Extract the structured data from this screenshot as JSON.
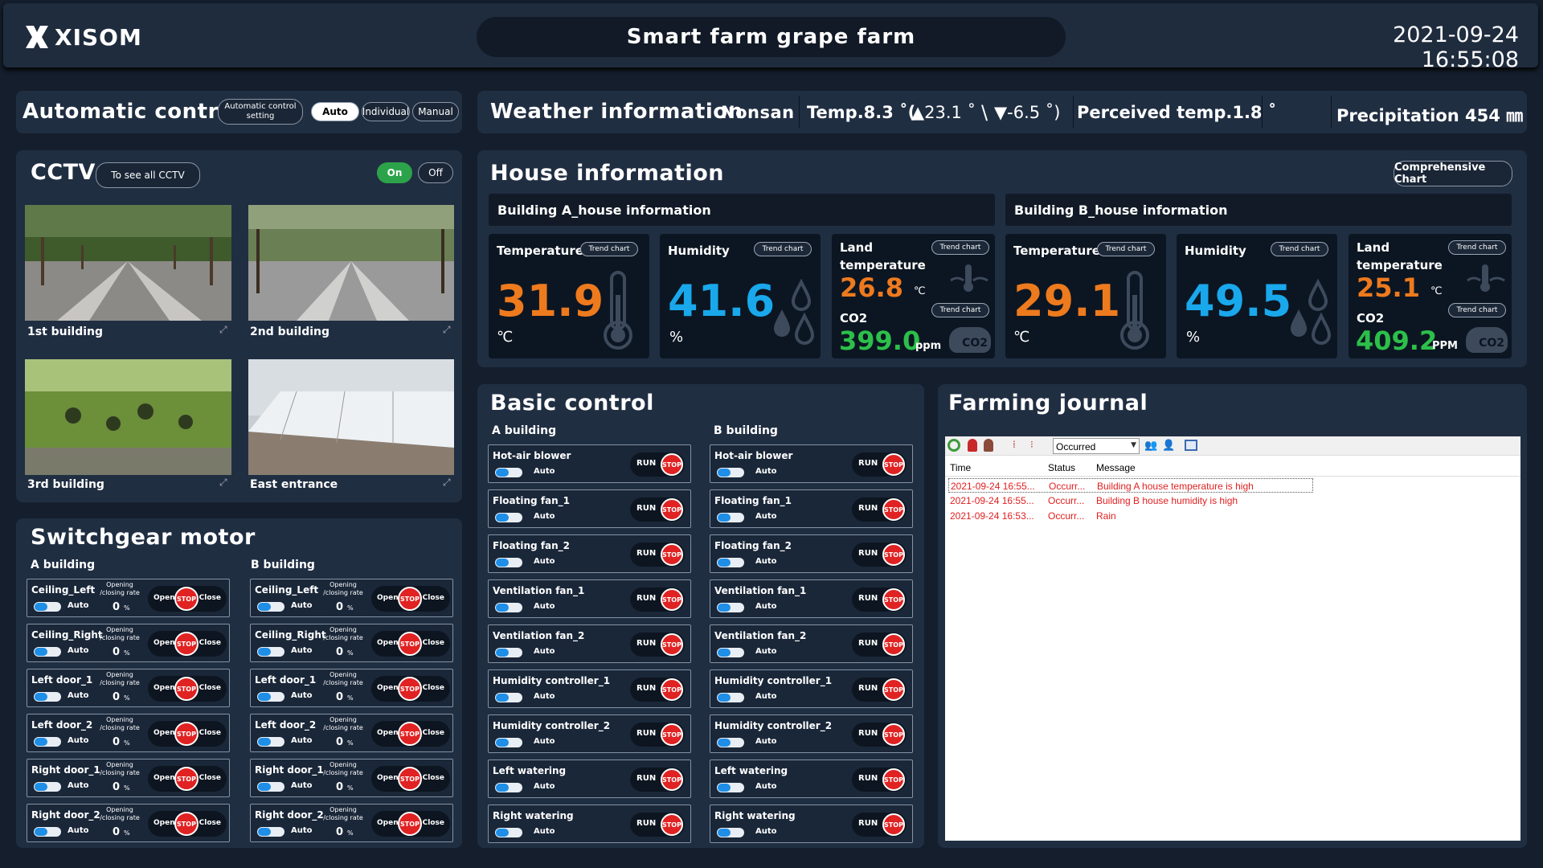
{
  "header": {
    "logo": "XISOM",
    "title": "Smart farm grape farm",
    "datetime": "2021-09-24 16:55:08"
  },
  "auto_control": {
    "title": "Automatic control",
    "setting_line1": "Automatic control",
    "setting_line2": "setting",
    "modes": [
      "Auto",
      "Individual",
      "Manual"
    ],
    "active_mode": "Auto"
  },
  "weather": {
    "title": "Weather information",
    "location": "Nonsan",
    "temp": "Temp.8.3 ˚(",
    "high": "▲23.1 ˚",
    "sep": "\\",
    "low": "▼-6.5 ˚)",
    "perceived": "Perceived temp.1.8 ˚",
    "precip": "Precipitation 454 ㎜"
  },
  "cctv": {
    "title": "CCTV",
    "see_all": "To see all CCTV",
    "on": "On",
    "off": "Off",
    "cams": [
      "1st building",
      "2nd building",
      "3rd building",
      "East entrance"
    ]
  },
  "house": {
    "title": "House information",
    "chart_button": "Comprehensive Chart",
    "a_title": "Building A_house information",
    "b_title": "Building B_house information",
    "trend": "Trend chart",
    "labels": {
      "temperature": "Temperature",
      "humidity": "Humidity",
      "land1": "Land",
      "land2": "temperature",
      "co2": "CO2"
    },
    "units": {
      "celsius": "℃",
      "percent": "%",
      "ppm": "ppm",
      "ppm_b": "PPM",
      "co2_icon": "CO2"
    },
    "a": {
      "temp": "31.9",
      "hum": "41.6",
      "land": "26.8",
      "co2": "399.0"
    },
    "b": {
      "temp": "29.1",
      "hum": "49.5",
      "land": "25.1",
      "co2": "409.2"
    }
  },
  "switchgear": {
    "title": "Switchgear motor",
    "a": "A building",
    "b": "B building",
    "rate1": "Opening",
    "rate2": "/closing rate",
    "rate_value": "0",
    "rate_unit": "%",
    "auto": "Auto",
    "open": "Open",
    "stop": "STOP",
    "close": "Close",
    "items": [
      "Ceiling_Left",
      "Ceiling_Right",
      "Left door_1",
      "Left door_2",
      "Right door_1",
      "Right door_2"
    ]
  },
  "basic": {
    "title": "Basic control",
    "a": "A building",
    "b": "B building",
    "auto": "Auto",
    "run": "RUN",
    "stop": "STOP",
    "items": [
      "Hot-air blower",
      "Floating fan_1",
      "Floating fan_2",
      "Ventilation fan_1",
      "Ventilation fan_2",
      "Humidity controller_1",
      "Humidity controller_2",
      "Left watering",
      "Right watering"
    ]
  },
  "journal": {
    "title": "Farming journal",
    "filter": "Occurred",
    "cols": [
      "Time",
      "Status",
      "Message"
    ],
    "rows": [
      [
        "2021-09-24 16:55...",
        "Occurr...",
        "Building A house temperature is high"
      ],
      [
        "2021-09-24 16:55...",
        "Occurr...",
        "Building B house humidity is high"
      ],
      [
        "2021-09-24 16:53...",
        "Occurr...",
        "Rain"
      ]
    ],
    "colors": {
      "alert": "#e02020"
    }
  }
}
